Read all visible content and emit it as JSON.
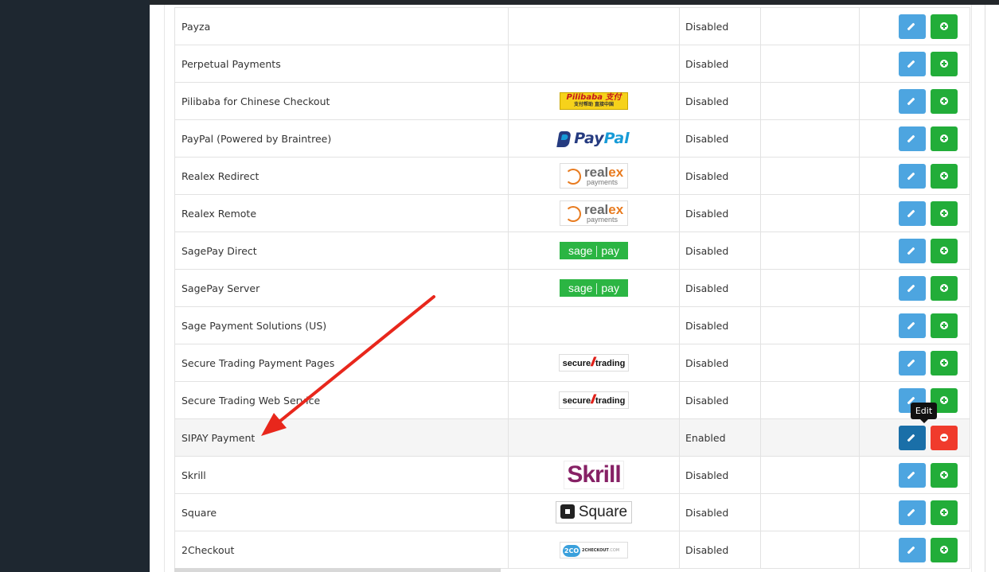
{
  "gateways": [
    {
      "name": "Payza",
      "logo": "",
      "status": "Disabled",
      "installed": false
    },
    {
      "name": "Perpetual Payments",
      "logo": "",
      "status": "Disabled",
      "installed": false
    },
    {
      "name": "Pilibaba for Chinese Checkout",
      "logo": "pilibaba",
      "status": "Disabled",
      "installed": false
    },
    {
      "name": "PayPal (Powered by Braintree)",
      "logo": "paypal",
      "status": "Disabled",
      "installed": false
    },
    {
      "name": "Realex Redirect",
      "logo": "realex",
      "status": "Disabled",
      "installed": false
    },
    {
      "name": "Realex Remote",
      "logo": "realex",
      "status": "Disabled",
      "installed": false
    },
    {
      "name": "SagePay Direct",
      "logo": "sagepay",
      "status": "Disabled",
      "installed": false
    },
    {
      "name": "SagePay Server",
      "logo": "sagepay",
      "status": "Disabled",
      "installed": false
    },
    {
      "name": "Sage Payment Solutions (US)",
      "logo": "",
      "status": "Disabled",
      "installed": false
    },
    {
      "name": "Secure Trading Payment Pages",
      "logo": "securetrading",
      "status": "Disabled",
      "installed": false
    },
    {
      "name": "Secure Trading Web Service",
      "logo": "securetrading",
      "status": "Disabled",
      "installed": false
    },
    {
      "name": "SIPAY Payment",
      "logo": "",
      "status": "Enabled",
      "installed": true
    },
    {
      "name": "Skrill",
      "logo": "skrill",
      "status": "Disabled",
      "installed": false
    },
    {
      "name": "Square",
      "logo": "square",
      "status": "Disabled",
      "installed": false
    },
    {
      "name": "2Checkout",
      "logo": "2checkout",
      "status": "Disabled",
      "installed": false
    }
  ],
  "logos": {
    "pilibaba": {
      "text": "Pilibaba 支付",
      "sub": "支付帮助 直接中国"
    },
    "paypal": {
      "a": "Pay",
      "b": "Pal"
    },
    "realex": {
      "a": "real",
      "b": "ex",
      "sub": "payments"
    },
    "sagepay": {
      "a": "sage",
      "b": "pay"
    },
    "securetrading": {
      "a": "secure",
      "b": "trading"
    },
    "skrill": {
      "text": "Skrill"
    },
    "square": {
      "text": "Square"
    },
    "twocheckout": {
      "mark": "2CO",
      "text": "2CHECKOUT",
      "suffix": ".COM"
    }
  },
  "tooltip": {
    "text": "Edit"
  },
  "highlight_row": "SIPAY Payment",
  "colors": {
    "edit": "#4da5e0",
    "edit_active": "#1a6fa8",
    "install": "#22ad39",
    "uninstall": "#f03b2c",
    "arrow": "#e8271c"
  }
}
